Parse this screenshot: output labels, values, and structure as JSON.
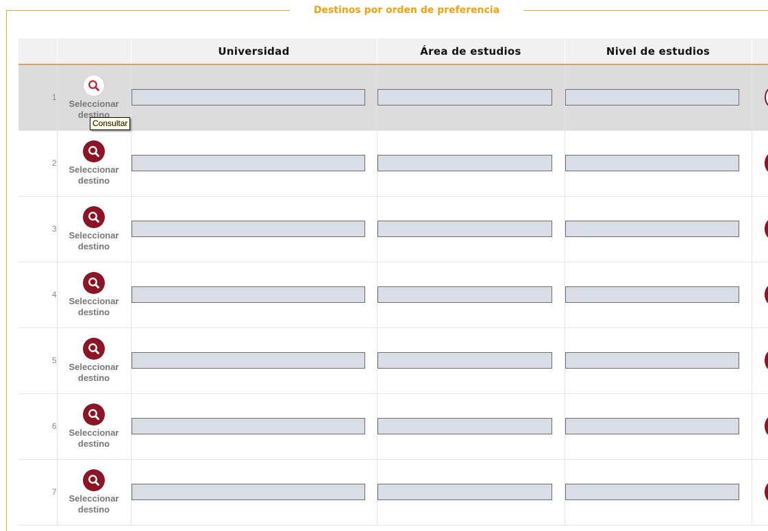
{
  "legend": "Destinos por orden de preferencia",
  "table": {
    "headers": [
      "",
      "",
      "Universidad",
      "Área de estudios",
      "Nivel de estudios",
      ""
    ],
    "rows": [
      {
        "number": "1",
        "select_label": "Seleccionar destino"
      },
      {
        "number": "2",
        "select_label": "Seleccionar destino"
      },
      {
        "number": "3",
        "select_label": "Seleccionar destino"
      },
      {
        "number": "4",
        "select_label": "Seleccionar destino"
      },
      {
        "number": "5",
        "select_label": "Seleccionar destino"
      },
      {
        "number": "6",
        "select_label": "Seleccionar destino"
      },
      {
        "number": "7",
        "select_label": "Seleccionar destino"
      }
    ]
  },
  "tooltip": "Consultar",
  "icons": {
    "select": "search-icon"
  },
  "colors": {
    "accent": "#f5a623",
    "button": "#8c1424",
    "field": "#d8dde6",
    "highlight_row": "#dcdcdc"
  }
}
